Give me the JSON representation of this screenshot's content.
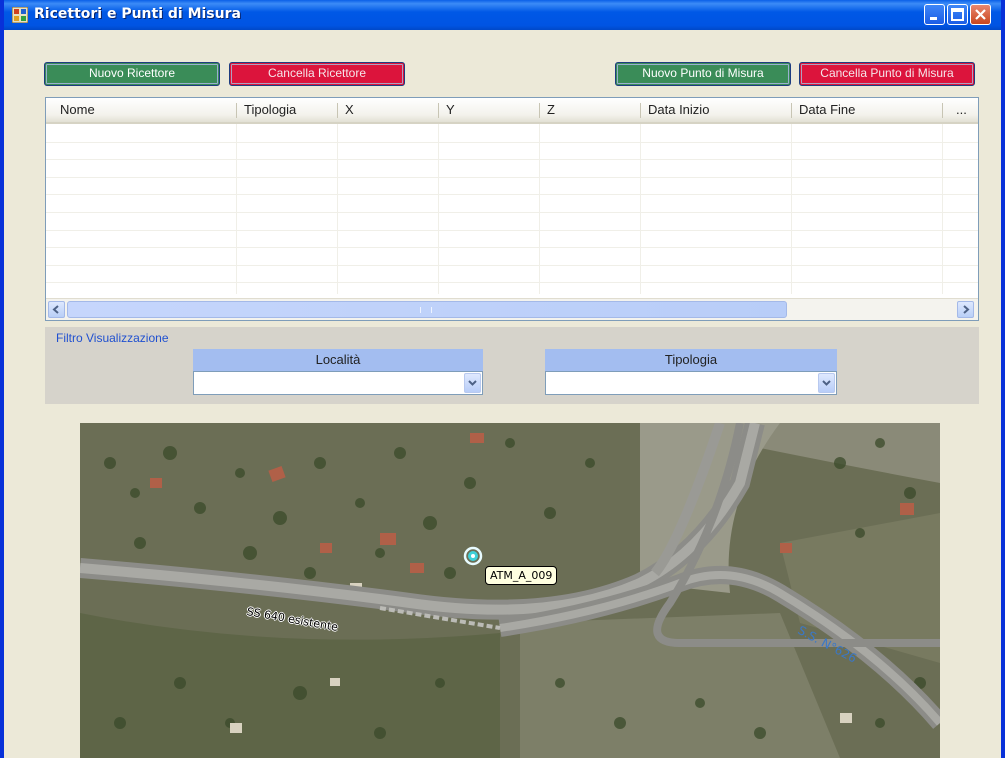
{
  "window": {
    "title": "Ricettori e Punti di Misura"
  },
  "toolbar": {
    "new_receiver": "Nuovo Ricettore",
    "delete_receiver": "Cancella Ricettore",
    "new_point": "Nuovo Punto di Misura",
    "delete_point": "Cancella Punto di Misura"
  },
  "grid": {
    "columns": [
      "Nome",
      "Tipologia",
      "X",
      "Y",
      "Z",
      "Data Inizio",
      "Data Fine",
      "..."
    ],
    "rows": []
  },
  "filter": {
    "title": "Filtro Visualizzazione",
    "locality_label": "Località",
    "locality_value": "",
    "type_label": "Tipologia",
    "type_value": ""
  },
  "map": {
    "point_label": "ATM_A_009",
    "road_label_1": "SS 640 esistente",
    "road_label_2": "S.S. N°626"
  },
  "colors": {
    "green_button": "#3a8c58",
    "red_button": "#dc143c",
    "titlebar": "#0054e3",
    "filter_header": "#a3bdf0"
  }
}
